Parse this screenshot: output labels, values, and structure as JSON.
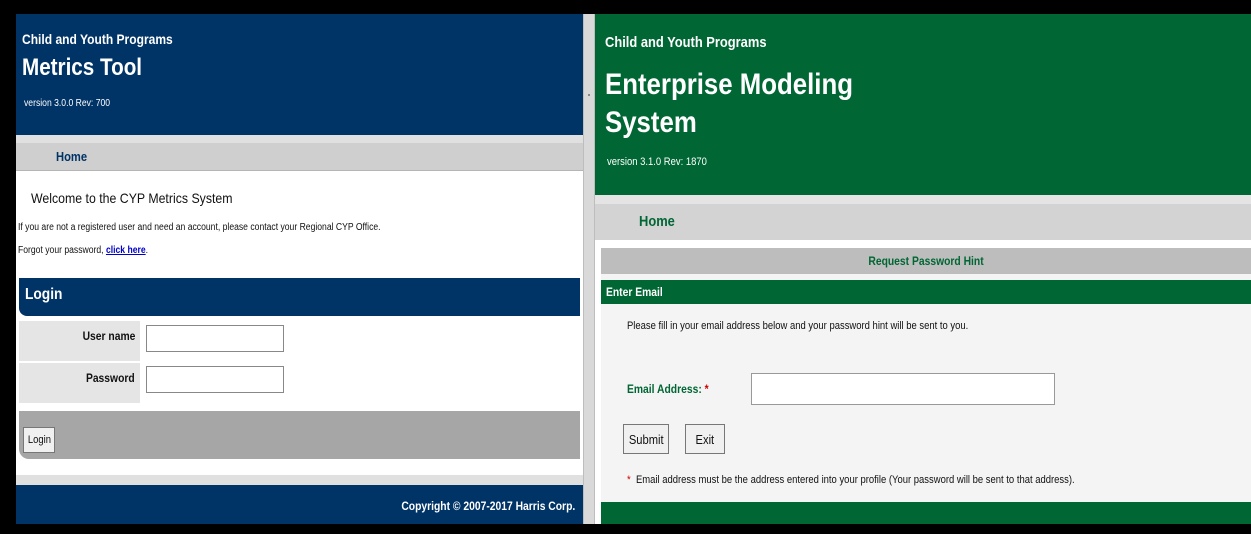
{
  "left_app": {
    "program": "Child and Youth Programs",
    "title": "Metrics Tool",
    "version": "version 3.0.0 Rev: 700",
    "nav_home": "Home",
    "welcome": "Welcome to the CYP Metrics System",
    "info": "If you are not a registered user and need an account, please contact your Regional CYP Office.",
    "forgot_prefix": "Forgot your password, ",
    "forgot_link": "click here",
    "forgot_suffix": ".",
    "login_header": "Login",
    "username_label": "User name",
    "username_value": "",
    "password_label": "Password",
    "password_value": "",
    "login_button": "Login",
    "copyright": "Copyright © 2007-2017 Harris Corp.",
    "header_color": "#003366"
  },
  "right_app": {
    "program": "Child and Youth Programs",
    "title": "Enterprise Modeling System",
    "version": "version 3.1.0 Rev: 1870",
    "nav_home": "Home",
    "section_title": "Request Password Hint",
    "panel_header": "Enter Email",
    "instructions": "Please fill in your email address below and your password hint will be sent to you.",
    "email_label": "Email Address:",
    "required_marker": "*",
    "email_value": "",
    "submit_button": "Submit",
    "exit_button": "Exit",
    "note_marker": "*",
    "note": "Email address must be the address entered into your profile (Your password will be sent to that address).",
    "header_color": "#006633"
  }
}
